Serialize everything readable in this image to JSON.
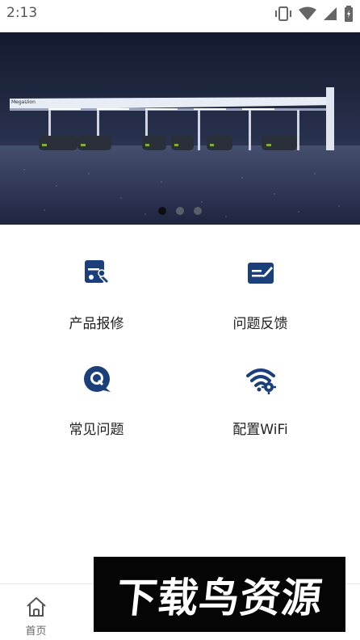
{
  "status_bar": {
    "time": "2:13",
    "icons": [
      "vibrate-icon",
      "wifi-icon",
      "signal-icon",
      "battery-icon"
    ]
  },
  "banner": {
    "brand_text": "MegaUion",
    "slides": 3,
    "active_slide": 1
  },
  "features": [
    {
      "label": "产品报修",
      "icon": "repair-icon"
    },
    {
      "label": "问题反馈",
      "icon": "feedback-icon"
    },
    {
      "label": "常见问题",
      "icon": "faq-icon"
    },
    {
      "label": "配置WiFi",
      "icon": "wifi-config-icon"
    }
  ],
  "tabbar": {
    "items": [
      {
        "label": "首页",
        "icon": "home-icon"
      },
      {
        "label": "",
        "icon": "tab-2-icon"
      },
      {
        "label": "",
        "icon": "tab-3-icon"
      },
      {
        "label": "",
        "icon": "tab-4-icon"
      },
      {
        "label": "",
        "icon": "tab-5-icon"
      }
    ]
  },
  "watermark": {
    "text": "下载鸟资源"
  },
  "colors": {
    "accent": "#1a3f7a",
    "banner_bg": "#1b2236"
  }
}
